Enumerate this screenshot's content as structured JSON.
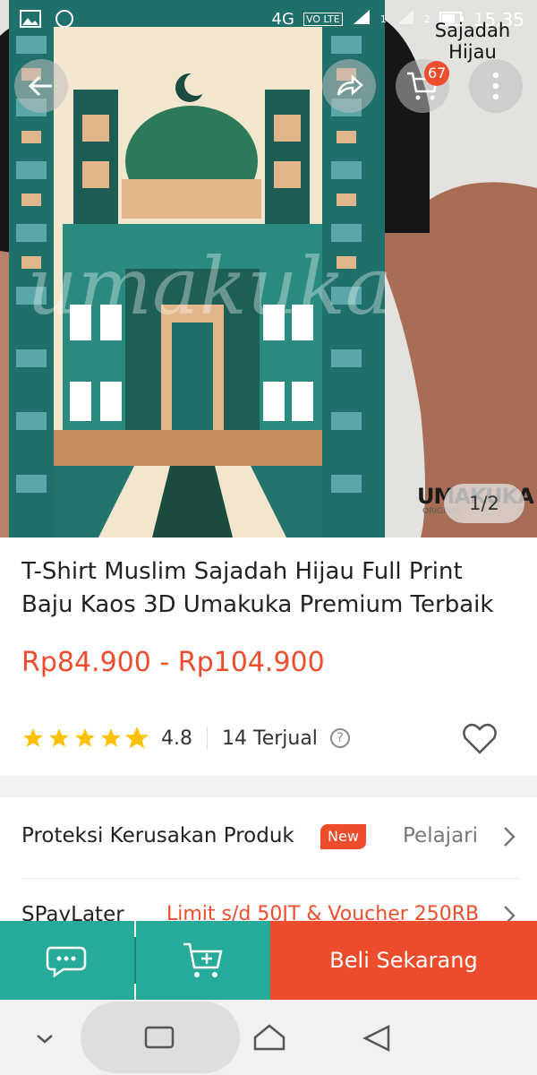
{
  "status_bar": {
    "network": "4G",
    "volte": "VO LTE",
    "sim1": "1",
    "sim2": "2",
    "time": "15.35"
  },
  "top_bar": {
    "shop_name": "Sajadah Hijau",
    "cart_count": "67"
  },
  "gallery": {
    "counter": "1/2",
    "brand": "UMAKUKA",
    "brand_sub": "ORIGINAL"
  },
  "product": {
    "title": "T-Shirt Muslim Sajadah Hijau Full Print Baju Kaos 3D Umakuka Premium Terbaik",
    "price_range": "Rp84.900 - Rp104.900",
    "rating": "4.8",
    "rating_value": 4.8,
    "sold": "14 Terjual",
    "help_glyph": "?"
  },
  "protection": {
    "label": "Proteksi Kerusakan Produk",
    "badge": "New",
    "link": "Pelajari"
  },
  "paylater": {
    "label": "SPayLater",
    "promo": "Limit s/d 50JT & Voucher 250RB"
  },
  "action_bar": {
    "buy_label": "Beli Sekarang"
  },
  "colors": {
    "accent": "#ee4d2d",
    "teal": "#26aa99",
    "star": "#ffc107"
  },
  "icons": {
    "back": "arrow-left-icon",
    "share": "share-icon",
    "cart": "cart-icon",
    "more": "more-vertical-icon",
    "chat": "chat-icon",
    "add_cart": "add-to-cart-icon",
    "heart": "heart-icon",
    "chevron": "chevron-right-icon"
  }
}
